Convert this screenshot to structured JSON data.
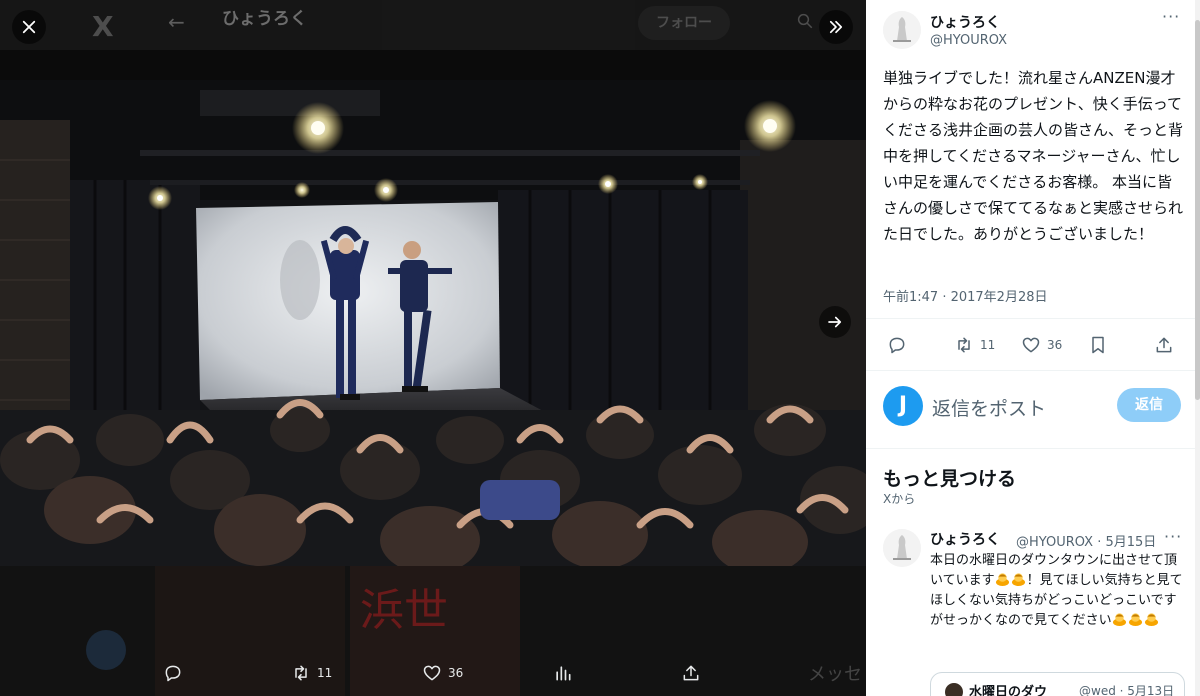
{
  "viewer": {
    "close_icon": "close-icon",
    "collapse_icon": "chevrons-right-icon",
    "next_icon": "arrow-right-icon",
    "background_header": {
      "logo": "X",
      "back_icon": "arrow-left-icon",
      "profile_name": "ひょうろく",
      "follow_label": "フォロー",
      "search_icon": "search-icon"
    },
    "background_bottom": {
      "poster_scrawl": "浜世",
      "messages_label": "メッセ"
    },
    "actions": {
      "reply_icon": "reply-icon",
      "retweet_icon": "retweet-icon",
      "retweet_count": "11",
      "like_icon": "heart-icon",
      "like_count": "36",
      "views_icon": "bar-chart-icon",
      "share_icon": "share-icon"
    }
  },
  "tweet": {
    "author": {
      "name": "ひょうろく",
      "handle": "@HYOUROX"
    },
    "more_icon": "more-dots-icon",
    "text": "単独ライブでした！流れ星さんANZEN漫才からの粋なお花のプレゼント、快く手伝ってくださる浅井企画の芸人の皆さん、そっと背中を押してくださるマネージャーさん、忙しい中足を運んでくださるお客様。 本当に皆さんの優しさで保ててるなぁと実感させられた日でした。ありがとうございました！",
    "timestamp": "午前1:47 · 2017年2月28日",
    "actions": {
      "reply_icon": "reply-icon",
      "retweet_icon": "retweet-icon",
      "retweet_count": "11",
      "like_icon": "heart-icon",
      "like_count": "36",
      "bookmark_icon": "bookmark-icon",
      "share_icon": "share-icon"
    }
  },
  "reply_box": {
    "avatar_letter": "J",
    "placeholder": "返信をポスト",
    "button_label": "返信"
  },
  "discover": {
    "title": "もっと見つける",
    "subtitle": "Xから",
    "post": {
      "name": "ひょうろく",
      "handle_date": "@HYOUROX · 5月15日",
      "text_parts": [
        "本日の水曜日のダウンタウンに出させて頂いています",
        "！見てほしい気持ちと見てほしくない気持ちがどっこいどっこいですがせっかくなので見てください"
      ],
      "emoji_icon": "bowing-person-emoji-icon",
      "quote": {
        "name": "水曜日のダウ",
        "meta": "@wed · 5月13日"
      }
    }
  },
  "colors": {
    "accent": "#1d9bf0",
    "reply_button_disabled": "#8ecdf8",
    "text_primary": "#0f1419",
    "text_secondary": "#536471",
    "viewer_bg": "#0b0b0b"
  }
}
